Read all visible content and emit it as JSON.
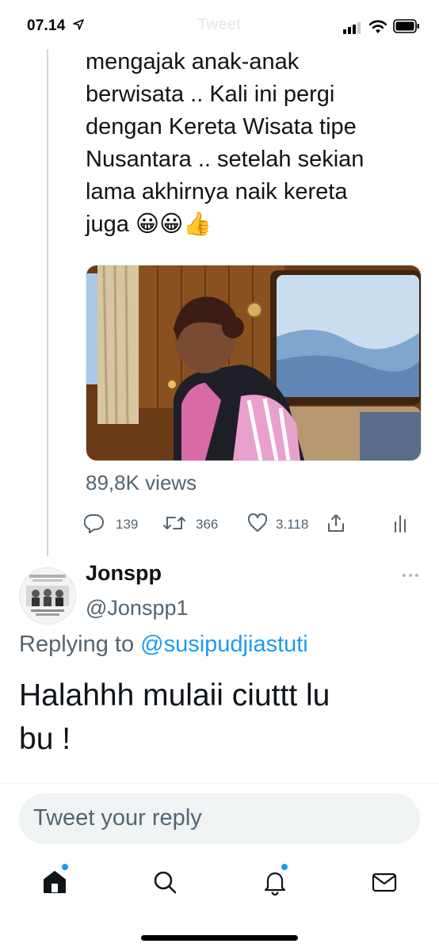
{
  "status_bar": {
    "time": "07.14"
  },
  "header": {
    "title": "Tweet"
  },
  "tweet": {
    "text_lines": [
      "mengajak anak-anak",
      "berwisata .. Kali ini pergi",
      "dengan Kereta Wisata tipe",
      "Nusantara .. setelah sekian",
      "lama akhirnya naik kereta",
      "juga 😀😀👍"
    ],
    "views": "89,8K views",
    "actions": {
      "replies": "139",
      "retweets": "366",
      "likes": "3.118"
    }
  },
  "reply": {
    "name": "Jonspp",
    "handle": "@Jonspp1",
    "replying_prefix": "Replying to",
    "replying_mention": "@susipudjiastuti",
    "text_lines": [
      "Halahhh mulaii ciuttt lu",
      "bu !"
    ]
  },
  "composer": {
    "placeholder": "Tweet your reply"
  },
  "colors": {
    "accent": "#1d9bf0",
    "secondary_text": "#536471",
    "primary_text": "#0f1419"
  }
}
